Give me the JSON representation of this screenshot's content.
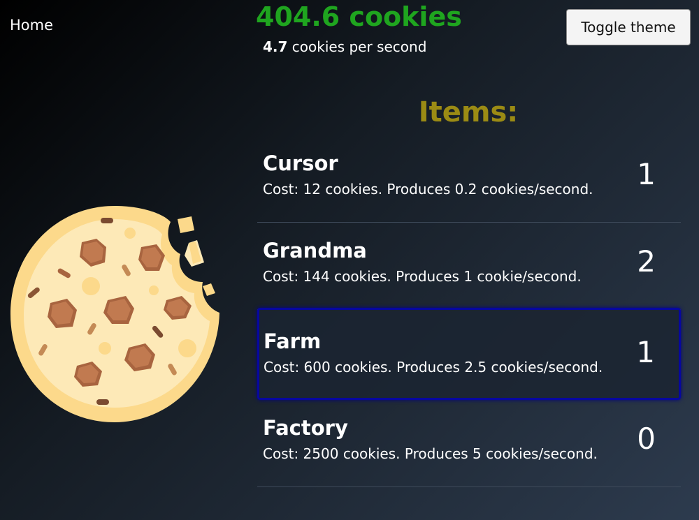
{
  "nav": {
    "home_label": "Home"
  },
  "header": {
    "cookie_count": "404.6 cookies",
    "cps_value": "4.7",
    "cps_suffix": " cookies per second",
    "toggle_theme_label": "Toggle theme"
  },
  "colors": {
    "cookie_count": "#1fa51f",
    "items_title": "#9b8b14",
    "selected_border": "#07079f"
  },
  "cookie": {
    "icon": "cookie-icon"
  },
  "items": {
    "title": "Items:",
    "list": [
      {
        "name": "Cursor",
        "desc": "Cost: 12 cookies. Produces 0.2 cookies/second.",
        "count": "1"
      },
      {
        "name": "Grandma",
        "desc": "Cost: 144 cookies. Produces 1 cookie/second.",
        "count": "2"
      },
      {
        "name": "Farm",
        "desc": "Cost: 600 cookies. Produces 2.5 cookies/second.",
        "count": "1",
        "selected": true
      },
      {
        "name": "Factory",
        "desc": "Cost: 2500 cookies. Produces 5 cookies/second.",
        "count": "0"
      }
    ]
  }
}
